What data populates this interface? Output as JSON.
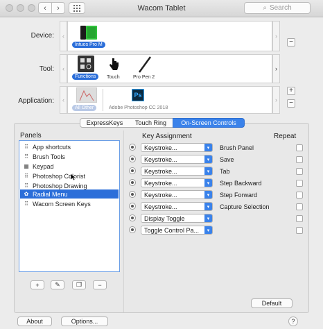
{
  "window": {
    "title": "Wacom Tablet"
  },
  "search": {
    "placeholder": "Search"
  },
  "device": {
    "label": "Device:",
    "items": [
      {
        "name": "Intuos Pro M",
        "selected": true
      }
    ]
  },
  "tool": {
    "label": "Tool:",
    "items": [
      {
        "name": "Functions",
        "selected": true
      },
      {
        "name": "Touch",
        "selected": false
      },
      {
        "name": "Pro Pen 2",
        "selected": false
      }
    ]
  },
  "application": {
    "label": "Application:",
    "items": [
      {
        "name": "All Other",
        "selected": true
      },
      {
        "name": "Adobe Photoshop CC 2018",
        "selected": false,
        "icon_text": "Ps"
      }
    ]
  },
  "tabs": [
    {
      "label": "ExpressKeys",
      "active": false
    },
    {
      "label": "Touch Ring",
      "active": false
    },
    {
      "label": "On-Screen Controls",
      "active": true
    }
  ],
  "panels": {
    "heading": "Panels",
    "items": [
      {
        "label": "App shortcuts",
        "icon": "grid-icon",
        "selected": false
      },
      {
        "label": "Brush Tools",
        "icon": "grid-icon",
        "selected": false
      },
      {
        "label": "Keypad",
        "icon": "keypad-icon",
        "selected": false
      },
      {
        "label": "Photoshop Colorist",
        "icon": "grid-icon",
        "selected": false
      },
      {
        "label": "Photoshop Drawing",
        "icon": "grid-icon",
        "selected": false
      },
      {
        "label": "Radial Menu",
        "icon": "radial-icon",
        "selected": true
      },
      {
        "label": "Wacom Screen Keys",
        "icon": "grid-icon",
        "selected": false
      }
    ]
  },
  "assignments": {
    "heading": "Key Assignment",
    "repeat_heading": "Repeat",
    "rows": [
      {
        "action": "Keystroke...",
        "name": "Brush Panel"
      },
      {
        "action": "Keystroke...",
        "name": "Save"
      },
      {
        "action": "Keystroke...",
        "name": "Tab"
      },
      {
        "action": "Keystroke...",
        "name": "Step Backward"
      },
      {
        "action": "Keystroke...",
        "name": "Step Forward"
      },
      {
        "action": "Keystroke...",
        "name": "Capture Selection"
      },
      {
        "action": "Display Toggle",
        "name": ""
      },
      {
        "action": "Toggle Control Pa...",
        "name": ""
      }
    ]
  },
  "buttons": {
    "default": "Default",
    "about": "About",
    "options": "Options...",
    "help": "?"
  },
  "colors": {
    "accent": "#2b6ed9",
    "device_green": "#2fc33a"
  }
}
